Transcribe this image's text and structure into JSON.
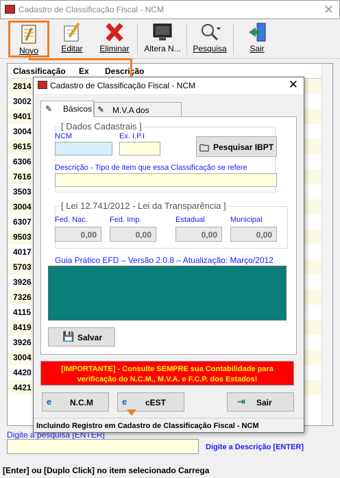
{
  "main": {
    "title": "Cadastro de Classificação Fiscal - NCM",
    "toolbar": {
      "novo": "Novo",
      "editar": "Editar",
      "eliminar": "Eliminar",
      "altera": "Altera N...",
      "pesquisa": "Pesquisa",
      "sair": "Sair"
    },
    "grid": {
      "headers": [
        "Classificação",
        "Ex",
        "Descrição"
      ],
      "rows": [
        "2814",
        "3002",
        "9401",
        "3004",
        "9615",
        "6306",
        "7616",
        "3503",
        "3004",
        "6307",
        "9503",
        "4017",
        "5703",
        "3926",
        "7326",
        "4115",
        "8419",
        "3926",
        "3004",
        "4420",
        "4421"
      ]
    },
    "search_label": "Digite a pesquisa [ENTER]",
    "search_desc": "Digite a Descrição [ENTER]",
    "footer": "[Enter] ou [Duplo Click] no item selecionado Carrega"
  },
  "dialog": {
    "title": "Cadastro de Classificação Fiscal - NCM",
    "tabs": [
      "Básicos",
      "M.V.A dos Estados"
    ],
    "dados_title": "[ Dados Cadastrais ]",
    "ncm_label": "NCM",
    "exipi_label": "Ex. I.P.I",
    "pesquisar_ibpt": "Pesquisar IBPT",
    "descricao_label": "Descrição - Tipo de item que essa Classificação se refere",
    "lei_title": "[ Lei 12.741/2012 - Lei da Transparência ]",
    "lei_labels": [
      "Fed. Nac.",
      "Fed. Imp.",
      "Estadual",
      "Municipal"
    ],
    "lei_values": [
      "0,00",
      "0,00",
      "0,00",
      "0,00"
    ],
    "guia": "Guia Prático EFD – Versão 2.0.8 – Atualização: Março/2012",
    "salvar": "Salvar",
    "warning_line1": "[IMPORTANTE] - Consulte SEMPRE sua Contabilidade para",
    "warning_line2": "verificação do N.C.M., M.V.A. e F.C.P. dos Estados!",
    "btn_ncm": "N.C.M",
    "btn_cest": "cEST",
    "btn_sair": "Sair",
    "status": "Incluindo Registro em Cadastro de Classificação Fiscal - NCM"
  },
  "colors": {
    "accent": "#f07d24",
    "teal": "#0a7f7a",
    "warning_bg": "#ff0000",
    "warning_fg": "#ffff00",
    "link": "#1a1aff"
  }
}
